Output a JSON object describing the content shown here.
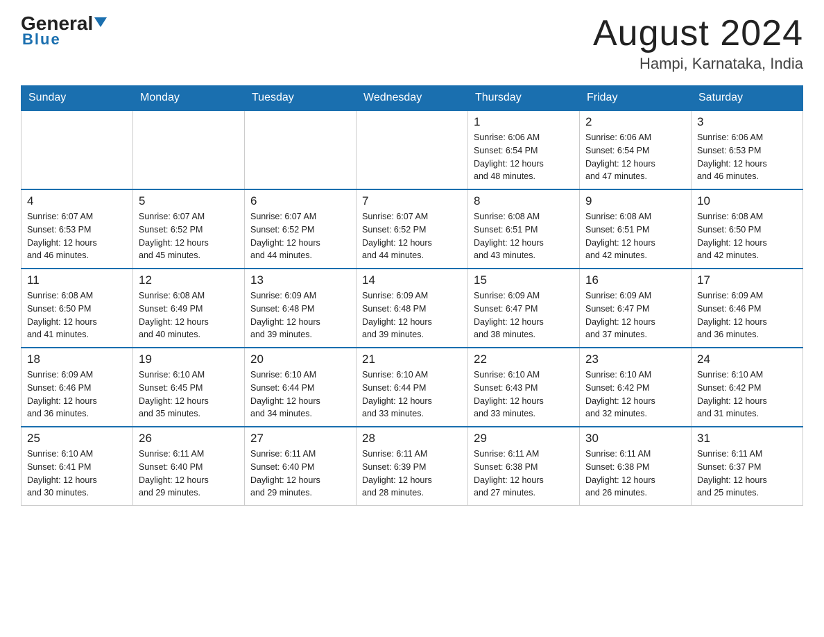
{
  "header": {
    "logo_main": "General",
    "logo_sub": "Blue",
    "month_title": "August 2024",
    "location": "Hampi, Karnataka, India"
  },
  "days_of_week": [
    "Sunday",
    "Monday",
    "Tuesday",
    "Wednesday",
    "Thursday",
    "Friday",
    "Saturday"
  ],
  "weeks": [
    [
      {
        "day": "",
        "info": ""
      },
      {
        "day": "",
        "info": ""
      },
      {
        "day": "",
        "info": ""
      },
      {
        "day": "",
        "info": ""
      },
      {
        "day": "1",
        "info": "Sunrise: 6:06 AM\nSunset: 6:54 PM\nDaylight: 12 hours\nand 48 minutes."
      },
      {
        "day": "2",
        "info": "Sunrise: 6:06 AM\nSunset: 6:54 PM\nDaylight: 12 hours\nand 47 minutes."
      },
      {
        "day": "3",
        "info": "Sunrise: 6:06 AM\nSunset: 6:53 PM\nDaylight: 12 hours\nand 46 minutes."
      }
    ],
    [
      {
        "day": "4",
        "info": "Sunrise: 6:07 AM\nSunset: 6:53 PM\nDaylight: 12 hours\nand 46 minutes."
      },
      {
        "day": "5",
        "info": "Sunrise: 6:07 AM\nSunset: 6:52 PM\nDaylight: 12 hours\nand 45 minutes."
      },
      {
        "day": "6",
        "info": "Sunrise: 6:07 AM\nSunset: 6:52 PM\nDaylight: 12 hours\nand 44 minutes."
      },
      {
        "day": "7",
        "info": "Sunrise: 6:07 AM\nSunset: 6:52 PM\nDaylight: 12 hours\nand 44 minutes."
      },
      {
        "day": "8",
        "info": "Sunrise: 6:08 AM\nSunset: 6:51 PM\nDaylight: 12 hours\nand 43 minutes."
      },
      {
        "day": "9",
        "info": "Sunrise: 6:08 AM\nSunset: 6:51 PM\nDaylight: 12 hours\nand 42 minutes."
      },
      {
        "day": "10",
        "info": "Sunrise: 6:08 AM\nSunset: 6:50 PM\nDaylight: 12 hours\nand 42 minutes."
      }
    ],
    [
      {
        "day": "11",
        "info": "Sunrise: 6:08 AM\nSunset: 6:50 PM\nDaylight: 12 hours\nand 41 minutes."
      },
      {
        "day": "12",
        "info": "Sunrise: 6:08 AM\nSunset: 6:49 PM\nDaylight: 12 hours\nand 40 minutes."
      },
      {
        "day": "13",
        "info": "Sunrise: 6:09 AM\nSunset: 6:48 PM\nDaylight: 12 hours\nand 39 minutes."
      },
      {
        "day": "14",
        "info": "Sunrise: 6:09 AM\nSunset: 6:48 PM\nDaylight: 12 hours\nand 39 minutes."
      },
      {
        "day": "15",
        "info": "Sunrise: 6:09 AM\nSunset: 6:47 PM\nDaylight: 12 hours\nand 38 minutes."
      },
      {
        "day": "16",
        "info": "Sunrise: 6:09 AM\nSunset: 6:47 PM\nDaylight: 12 hours\nand 37 minutes."
      },
      {
        "day": "17",
        "info": "Sunrise: 6:09 AM\nSunset: 6:46 PM\nDaylight: 12 hours\nand 36 minutes."
      }
    ],
    [
      {
        "day": "18",
        "info": "Sunrise: 6:09 AM\nSunset: 6:46 PM\nDaylight: 12 hours\nand 36 minutes."
      },
      {
        "day": "19",
        "info": "Sunrise: 6:10 AM\nSunset: 6:45 PM\nDaylight: 12 hours\nand 35 minutes."
      },
      {
        "day": "20",
        "info": "Sunrise: 6:10 AM\nSunset: 6:44 PM\nDaylight: 12 hours\nand 34 minutes."
      },
      {
        "day": "21",
        "info": "Sunrise: 6:10 AM\nSunset: 6:44 PM\nDaylight: 12 hours\nand 33 minutes."
      },
      {
        "day": "22",
        "info": "Sunrise: 6:10 AM\nSunset: 6:43 PM\nDaylight: 12 hours\nand 33 minutes."
      },
      {
        "day": "23",
        "info": "Sunrise: 6:10 AM\nSunset: 6:42 PM\nDaylight: 12 hours\nand 32 minutes."
      },
      {
        "day": "24",
        "info": "Sunrise: 6:10 AM\nSunset: 6:42 PM\nDaylight: 12 hours\nand 31 minutes."
      }
    ],
    [
      {
        "day": "25",
        "info": "Sunrise: 6:10 AM\nSunset: 6:41 PM\nDaylight: 12 hours\nand 30 minutes."
      },
      {
        "day": "26",
        "info": "Sunrise: 6:11 AM\nSunset: 6:40 PM\nDaylight: 12 hours\nand 29 minutes."
      },
      {
        "day": "27",
        "info": "Sunrise: 6:11 AM\nSunset: 6:40 PM\nDaylight: 12 hours\nand 29 minutes."
      },
      {
        "day": "28",
        "info": "Sunrise: 6:11 AM\nSunset: 6:39 PM\nDaylight: 12 hours\nand 28 minutes."
      },
      {
        "day": "29",
        "info": "Sunrise: 6:11 AM\nSunset: 6:38 PM\nDaylight: 12 hours\nand 27 minutes."
      },
      {
        "day": "30",
        "info": "Sunrise: 6:11 AM\nSunset: 6:38 PM\nDaylight: 12 hours\nand 26 minutes."
      },
      {
        "day": "31",
        "info": "Sunrise: 6:11 AM\nSunset: 6:37 PM\nDaylight: 12 hours\nand 25 minutes."
      }
    ]
  ]
}
